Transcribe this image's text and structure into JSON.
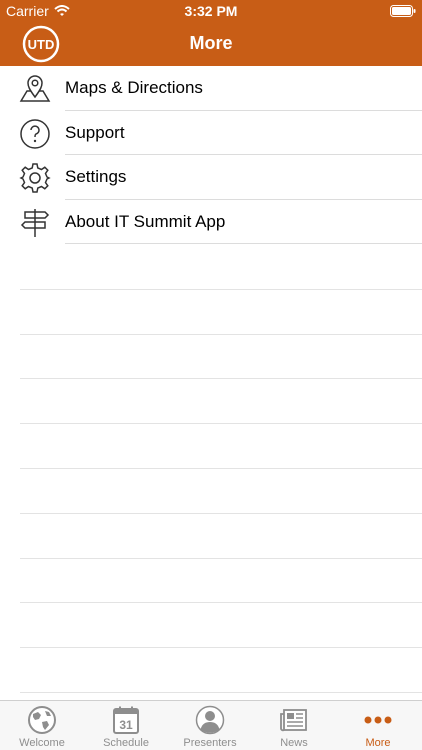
{
  "status_bar": {
    "carrier": "Carrier",
    "time": "3:32 PM"
  },
  "nav": {
    "title": "More",
    "logo_text": "UTD"
  },
  "menu": [
    {
      "label": "Maps & Directions",
      "icon": "map-pin-icon"
    },
    {
      "label": "Support",
      "icon": "question-icon"
    },
    {
      "label": "Settings",
      "icon": "gear-icon"
    },
    {
      "label": "About IT Summit App",
      "icon": "signpost-icon"
    }
  ],
  "tabs": [
    {
      "label": "Welcome",
      "icon": "globe-icon"
    },
    {
      "label": "Schedule",
      "icon": "calendar-icon",
      "calendar_day": "31"
    },
    {
      "label": "Presenters",
      "icon": "person-icon"
    },
    {
      "label": "News",
      "icon": "newspaper-icon"
    },
    {
      "label": "More",
      "icon": "more-dots-icon",
      "active": true
    }
  ],
  "colors": {
    "brand": "#c85d16",
    "tab_inactive": "#8e8e8e",
    "separator": "#dcdcdc"
  }
}
